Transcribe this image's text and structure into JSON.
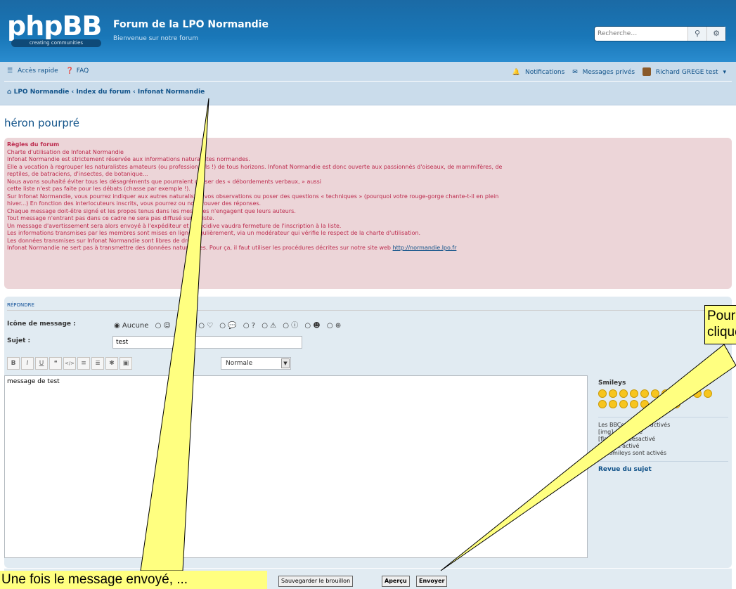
{
  "header": {
    "logo_text": "phpBB",
    "logo_tagline": "creating communities",
    "site_title": "Forum de la LPO Normandie",
    "site_description": "Bienvenue sur notre forum",
    "search_placeholder": "Recherche…"
  },
  "navbar": {
    "quick_links": "Accès rapide",
    "faq": "FAQ",
    "notifications": "Notifications",
    "private_messages": "Messages privés",
    "username": "Richard GREGE test",
    "breadcrumbs": [
      "LPO Normandie",
      "Index du forum",
      "Infonat Normandie"
    ]
  },
  "topic_title": "héron pourpré",
  "rules": {
    "title": "Règles du forum",
    "lines": [
      "Charte d'utilisation de Infonat Normandie",
      "Infonat Normandie est strictement réservée aux informations naturalistes normandes.",
      "Elle a vocation à regrouper les naturalistes amateurs (ou professionnels !) de tous horizons. Infonat Normandie est donc ouverte aux passionnés d'oiseaux, de mammifères, de",
      "reptiles, de batraciens, d'insectes, de botanique...",
      "Nous avons souhaité éviter tous les désagréments que pourraient causer des « débordements verbaux, » aussi",
      "cette liste n'est pas faite pour les débats (chasse par exemple !).",
      "Sur Infonat Normandie, vous pourrez indiquer aux autres naturalistes vos observations ou poser des questions « techniques » (pourquoi votre rouge-gorge chante-t-il en plein",
      "hiver...) En fonction des interlocuteurs inscrits, vous pourrez ou non trouver des réponses.",
      "Chaque message doit-être signé et les propos tenus dans les messages n'engagent que leurs auteurs.",
      "Tout message n'entrant pas dans ce cadre ne sera pas diffusé sur la liste.",
      "Un message d'avertissement sera alors envoyé à l'expéditeur et la récidive vaudra fermeture de l'inscription à la liste.",
      "Les informations transmises par les membres sont mises en ligne régulièrement, via un modérateur qui vérifie le respect de la charte d'utilisation.",
      "Les données transmises sur Infonat Normandie sont libres de droit."
    ],
    "last_line": "Infonat Normandie ne sert pas à transmettre des données naturalistes. Pour ça, il faut utiliser les procédures décrites sur notre site web",
    "link": "http://normandie.lpo.fr"
  },
  "form": {
    "heading": "RÉPONDRE",
    "icon_label": "Icône de message :",
    "icon_none": "Aucune",
    "subject_label": "Sujet :",
    "subject_value": "test",
    "font_size_value": "Normale",
    "message_value": "message de test",
    "toolbar": [
      "B",
      "I",
      "U",
      "❝",
      "</>",
      "≡",
      "≣",
      "✱",
      "▣"
    ],
    "smileys_title": "Smileys",
    "bbcode_lines": [
      "Les BBCodes sont activés",
      "[img] est activé",
      "[flash] est désactivé",
      "[url] est activé",
      "Les smileys sont activés"
    ],
    "topic_review": "Revue du sujet"
  },
  "buttons": {
    "save_draft": "Sauvegarder le brouillon",
    "preview": "Aperçu",
    "submit": "Envoyer"
  },
  "callouts": {
    "left_text": "Une fois le message envoyé, ...",
    "right_line1": "Pour",
    "right_line2": "cliquer"
  },
  "colors": {
    "header_blue": "#1977b8",
    "nav_bg": "#cadceb",
    "rules_bg": "#ecd5d8",
    "rules_text": "#bc2a4d",
    "form_bg": "#e1ebf2",
    "callout_yellow": "#ffff80"
  }
}
